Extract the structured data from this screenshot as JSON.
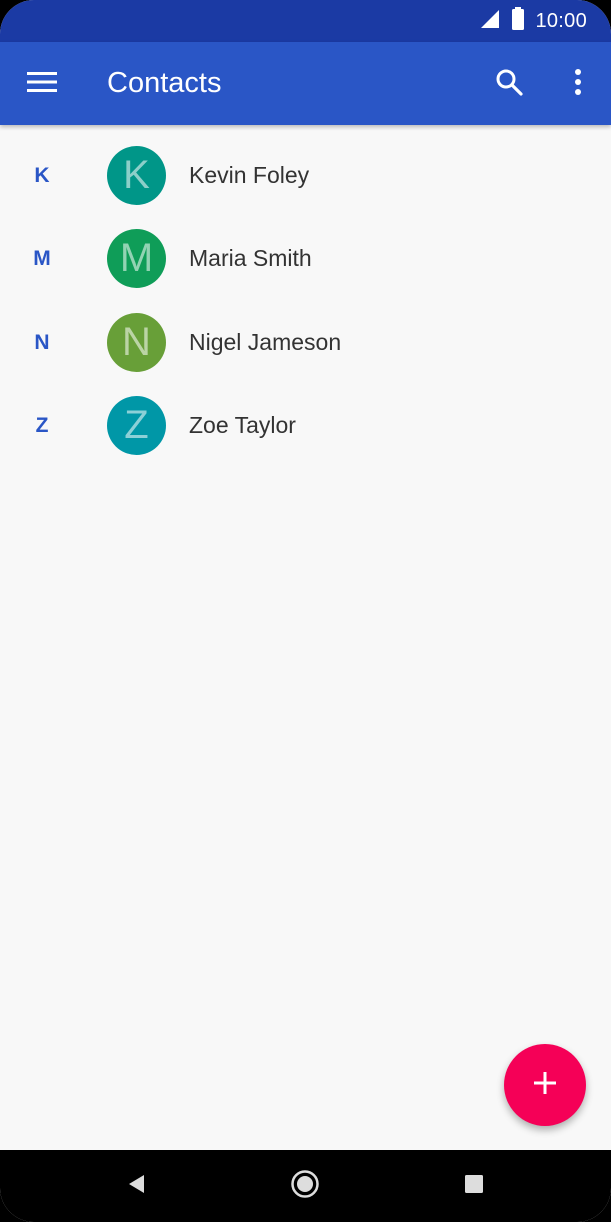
{
  "status_bar": {
    "time": "10:00",
    "icons": [
      "signal-icon",
      "battery-icon"
    ]
  },
  "app_bar": {
    "title": "Contacts",
    "icons": [
      "menu-icon",
      "search-icon",
      "more-vert-icon"
    ]
  },
  "contacts": [
    {
      "section": "K",
      "initial": "K",
      "name": "Kevin Foley",
      "avatar_color": "#009688"
    },
    {
      "section": "M",
      "initial": "M",
      "name": "Maria Smith",
      "avatar_color": "#0f9d58"
    },
    {
      "section": "N",
      "initial": "N",
      "name": "Nigel Jameson",
      "avatar_color": "#689f38"
    },
    {
      "section": "Z",
      "initial": "Z",
      "name": "Zoe Taylor",
      "avatar_color": "#0097a7"
    }
  ],
  "fab": {
    "icon": "add-icon"
  },
  "nav_bar": {
    "icons": [
      "back-icon",
      "home-icon",
      "recents-icon"
    ]
  },
  "colors": {
    "app_bar": "#2a56c6",
    "status_bar": "#1b3aa4",
    "accent": "#f50057",
    "section_letter": "#2a56c6"
  }
}
